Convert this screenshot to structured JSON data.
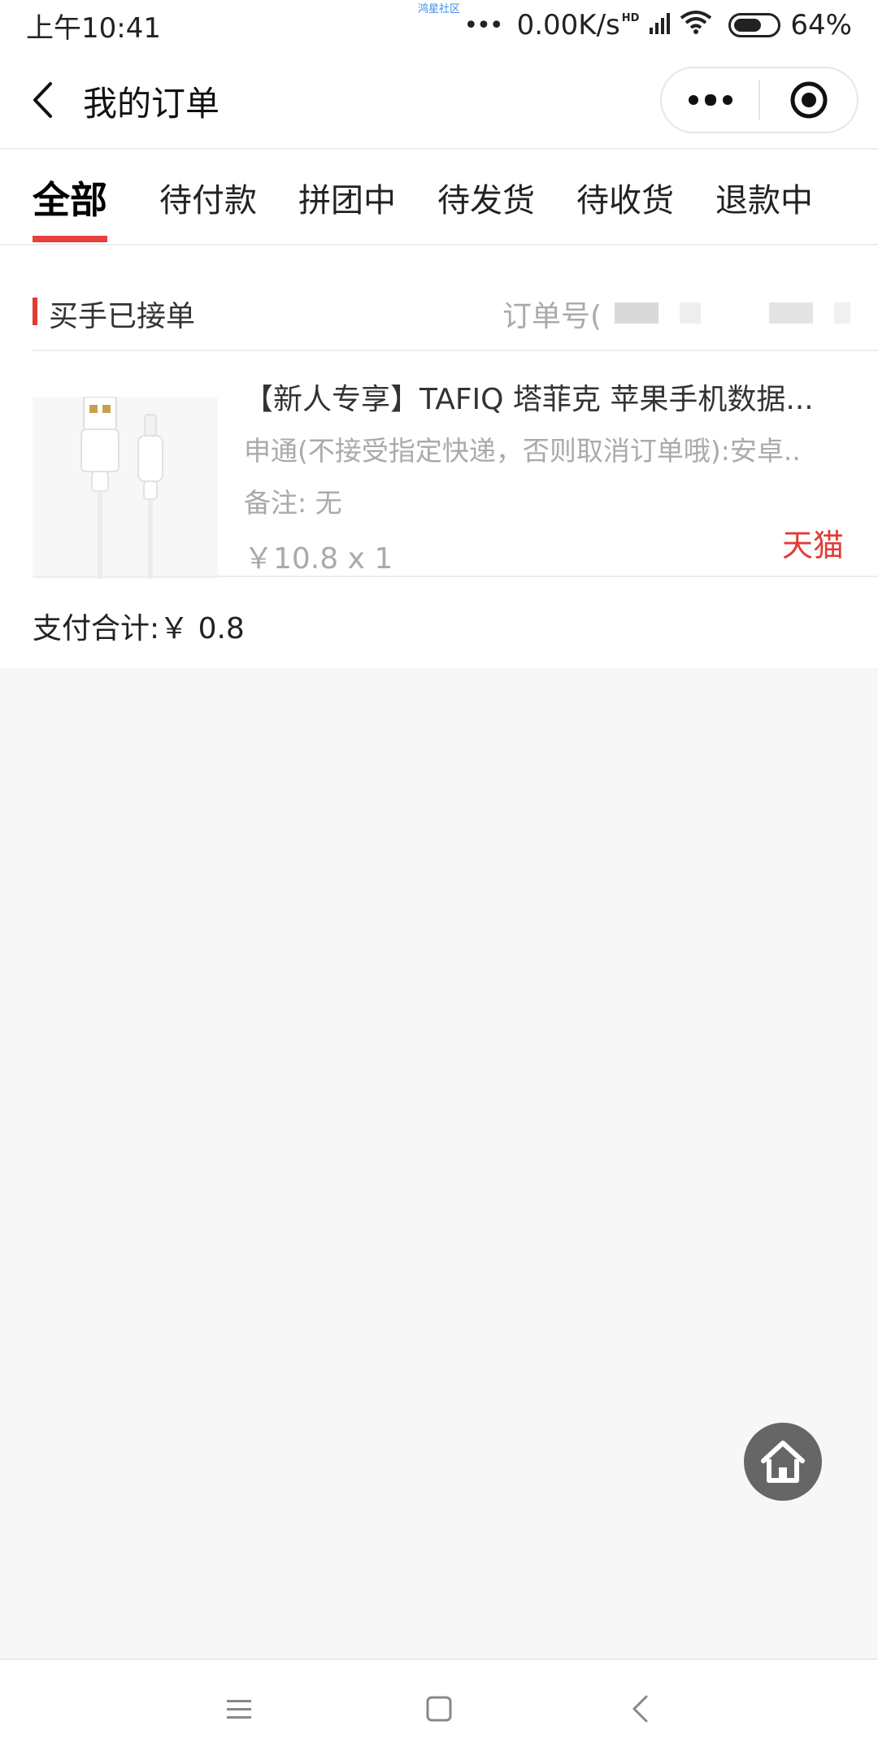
{
  "status_bar": {
    "time": "上午10:41",
    "watermark": "鸿星社区",
    "dots": "•••",
    "network_speed": "0.00K/s",
    "signal_badge": "HD",
    "battery_percent": "64%",
    "battery_level": 0.64
  },
  "nav": {
    "title": "我的订单"
  },
  "tabs": [
    {
      "label": "全部",
      "active": true
    },
    {
      "label": "待付款"
    },
    {
      "label": "拼团中"
    },
    {
      "label": "待发货"
    },
    {
      "label": "待收货"
    },
    {
      "label": "退款中"
    }
  ],
  "order": {
    "status": "买手已接单",
    "order_no_label": "订单号(",
    "product_title": "【新人专享】TAFIQ 塔菲克 苹果手机数据...",
    "product_spec": "申通(不接受指定快递，否则取消订单哦):安卓..",
    "note": "备注: 无",
    "price_qty": "￥10.8 x 1",
    "platform": "天猫",
    "pay_total": "支付合计:￥ 0.8"
  },
  "colors": {
    "accent": "#e23b36",
    "tab_underline": "#e8403d",
    "muted_text": "#aaaaaa",
    "page_bg": "#f7f7f7",
    "fab": "#666666"
  },
  "icons": {
    "back": "chevron-left-icon",
    "more": "more-dots-icon",
    "close_miniapp": "target-icon",
    "home": "home-icon",
    "menu": "menu-icon",
    "square": "square-icon",
    "back_nav": "chevron-left-icon"
  }
}
